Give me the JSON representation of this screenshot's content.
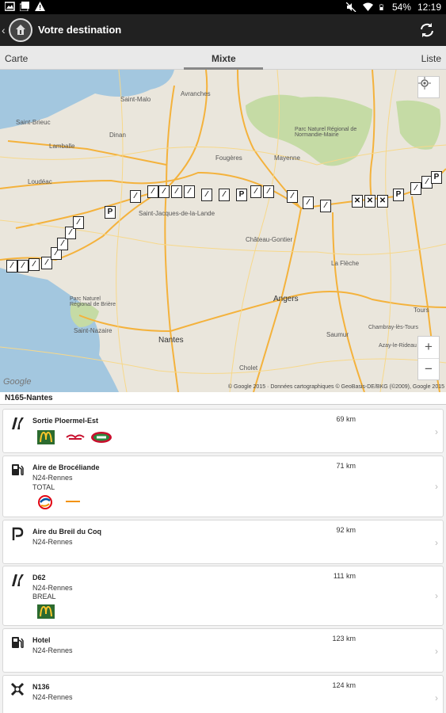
{
  "status_bar": {
    "battery": "54%",
    "time": "12:19"
  },
  "action_bar": {
    "title": "Votre destination"
  },
  "tabs": [
    {
      "label": "Carte"
    },
    {
      "label": "Mixte"
    },
    {
      "label": "Liste"
    }
  ],
  "map": {
    "labels": {
      "saint_malo": "Saint-Malo",
      "avranches": "Avranches",
      "saint_brieuc": "Saint-Brieuc",
      "lamballe": "Lamballe",
      "dinan": "Dinan",
      "fougeres": "Fougères",
      "mayenne": "Mayenne",
      "loudeac": "Loudéac",
      "normandie": "Parc Naturel Régional de Normandie-Maine",
      "saint_jacques": "Saint-Jacques-de-la-Lande",
      "chateau_gontier": "Château-Gontier",
      "la_fleche": "La Flèche",
      "angers": "Angers",
      "parc_briere": "Parc Naturel Régional de Brière",
      "saint_nazaire": "Saint-Nazaire",
      "nantes": "Nantes",
      "saumur": "Saumur",
      "tours": "Tours",
      "cholet": "Cholet",
      "chambray": "Chambray-lès-Tours",
      "azay": "Azay-le-Rideau"
    },
    "google": "Google",
    "attribution": "© Google 2015 · Données cartographiques © GeoBasis-DE/BKG (©2009), Google 2015",
    "zoom_in": "+",
    "zoom_out": "−"
  },
  "route_header": "N165-Nantes",
  "items": [
    {
      "icon": "exit-icon",
      "title": "Sortie Ploermel-Est",
      "distance": "69 km",
      "lines": [],
      "brands": [
        "mcdonalds",
        "brand-red",
        "brand-oval"
      ]
    },
    {
      "icon": "fuel-icon",
      "title": "Aire de Brocéliande",
      "distance": "71 km",
      "lines": [
        "N24-Rennes",
        "TOTAL"
      ],
      "brands": [
        "total",
        "brand-small"
      ]
    },
    {
      "icon": "parking-icon",
      "title": "Aire du Breil du Coq",
      "distance": "92 km",
      "lines": [
        "N24-Rennes"
      ],
      "brands": []
    },
    {
      "icon": "exit-icon",
      "title": "D62",
      "distance": "111 km",
      "lines": [
        "N24-Rennes",
        "BREAL"
      ],
      "brands": [
        "mcdonalds"
      ]
    },
    {
      "icon": "fuel-icon",
      "title": "Hotel",
      "distance": "123 km",
      "lines": [
        "N24-Rennes"
      ],
      "brands": []
    },
    {
      "icon": "interchange-icon",
      "title": "N136",
      "distance": "124 km",
      "lines": [
        "N24-Rennes"
      ],
      "brands": []
    }
  ]
}
